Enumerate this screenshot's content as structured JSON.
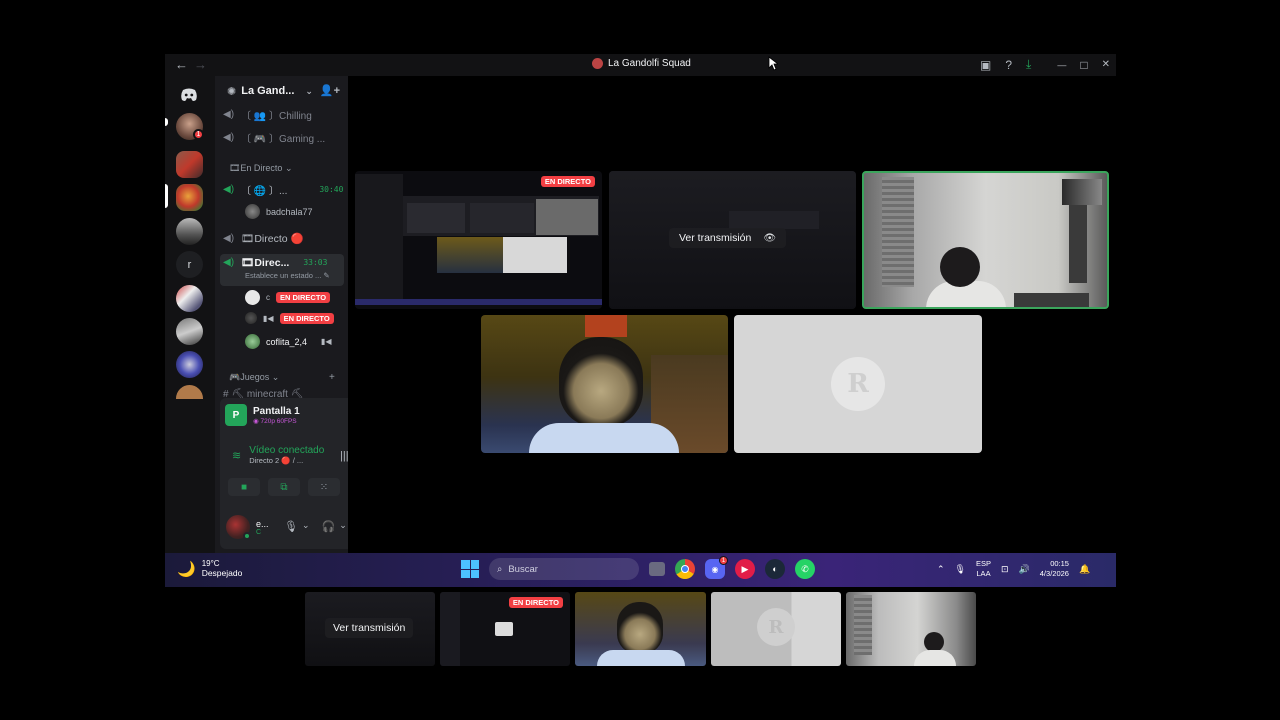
{
  "window": {
    "title": "La Gandolfi Squad",
    "back": "←",
    "forward": "→"
  },
  "titlebar_icons": [
    "inbox-icon",
    "help-icon",
    "download-icon",
    "minimize-icon",
    "maximize-icon",
    "close-icon"
  ],
  "titlebar_glyphs": {
    "inbox": "▣",
    "help": "?",
    "download": "⤓",
    "minimize": "—",
    "maximize": "□",
    "close": "✕"
  },
  "server": {
    "name": "La Gand...",
    "chevron": "⌄",
    "add_user": "👤+"
  },
  "rail": {
    "home": "◉",
    "letter": "r",
    "badge_count": "1"
  },
  "channels": {
    "chilling": "〔 👥 〕Chilling",
    "gaming": "〔 🎮 〕Gaming ...",
    "category_live": "🎞En Directo ⌄",
    "live_item": "〔 🌐 〕...",
    "live_item_time": "30:40",
    "live_user": "badchala77",
    "directo": "🎞Directo 🔴",
    "direc_active": "🎞Direc...",
    "direc_active_time": "33:03",
    "direc_status": "Establece un estado ... ✎",
    "user_c": "c",
    "user_cam": "▮◀",
    "user_coflita": "coflita_2,4",
    "user_coflita_icon": "▮◀",
    "live_badge": "EN DIRECTO",
    "category_games": "🎮Juegos ⌄",
    "category_games_add": "+",
    "minecraft": "#  ⛏ minecraft ⛏"
  },
  "panel": {
    "screen_icon": "P",
    "screen_title": "Pantalla 1",
    "screen_sub": "◉ 720p 60FPS",
    "screen_close": "⊠",
    "video_title": "Vídeo conectado",
    "video_sub": "Directo 2 🔴 / ...",
    "signal": "≋",
    "soundboard": "|||",
    "disconnect": "☎",
    "camera": "■",
    "share": "⧉",
    "activities": "⁙",
    "effects": "✦"
  },
  "me": {
    "name": "e...",
    "sub": "C",
    "mic": "🎙",
    "mic_chev": "⌄",
    "headset": "🎧",
    "headset_chev": "⌄",
    "settings": "⚙"
  },
  "stage": {
    "live_badge": "EN DIRECTO",
    "watch_label": "Ver transmisión",
    "watch_icon": "👁"
  },
  "taskbar": {
    "temp": "19°C",
    "weather": "Despejado",
    "moon": "🌙",
    "search_placeholder": "Buscar",
    "search_icon": "⌕",
    "discord_badge": "1",
    "chevron_up": "⌃",
    "mic": "🎙",
    "lang_top": "ESP",
    "lang_bottom": "LAA",
    "net": "⊡",
    "volume": "🔊",
    "time": "00:15",
    "date": "4/3/2026",
    "notif": "🔔"
  },
  "strip": {
    "watch_label": "Ver transmisión",
    "live_badge": "EN DIRECTO"
  },
  "colors": {
    "live_red": "#f23f43",
    "voice_green": "#23a55a",
    "speaking_border": "#3ba55c"
  }
}
